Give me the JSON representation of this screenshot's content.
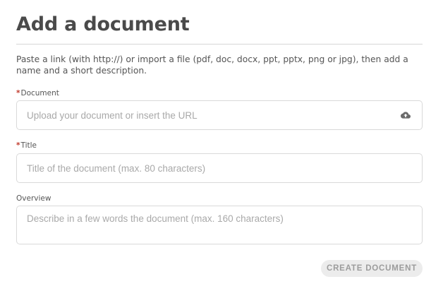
{
  "page": {
    "title": "Add a document",
    "description": "Paste a link (with http://) or import a file (pdf, doc, docx, ppt, pptx, png or jpg), then add a name and a short description."
  },
  "form": {
    "document": {
      "required_mark": "*",
      "label": "Document",
      "value": "",
      "placeholder": "Upload your document or insert the URL",
      "icon": "cloud-upload-icon"
    },
    "title": {
      "required_mark": "*",
      "label": "Title",
      "value": "",
      "placeholder": "Title of the document (max. 80 characters)"
    },
    "overview": {
      "label": "Overview",
      "value": "",
      "placeholder": "Describe in a few words the document (max. 160 characters)"
    },
    "submit_label": "CREATE DOCUMENT"
  },
  "colors": {
    "required": "#c0392b",
    "icon": "#6b6b6b",
    "button_bg": "#ececec",
    "button_text": "#9c9c9c",
    "border": "#d9d9d9"
  }
}
